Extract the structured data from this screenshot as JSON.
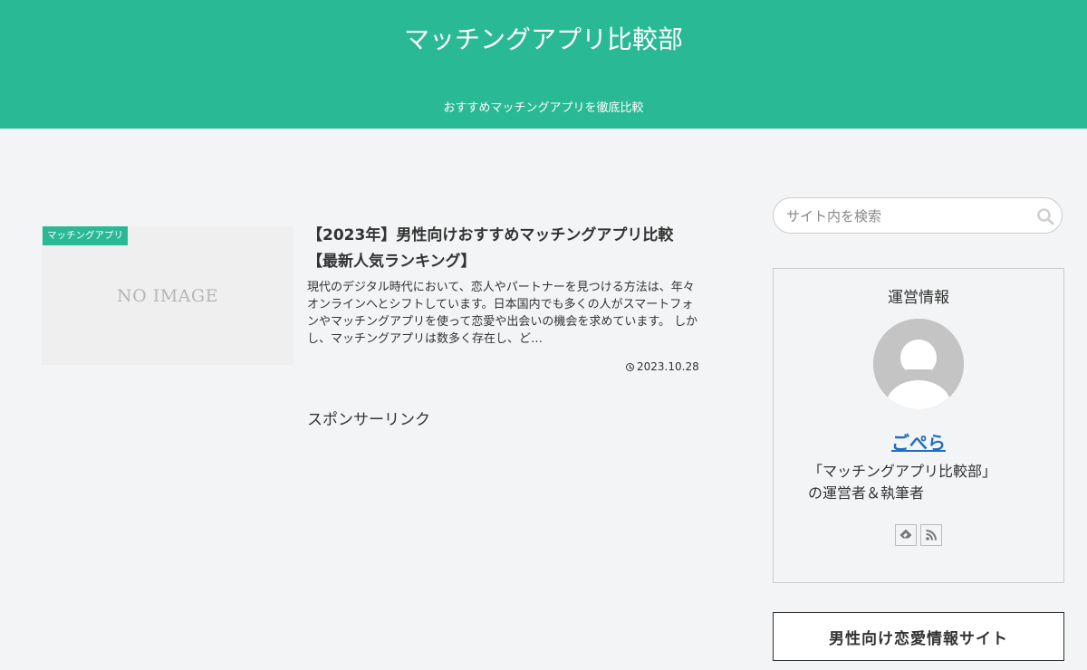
{
  "header": {
    "site_title": "マッチングアプリ比較部",
    "tagline": "おすすめマッチングアプリを徹底比較"
  },
  "article": {
    "category": "マッチングアプリ",
    "thumbnail_text": "NO IMAGE",
    "title_line1": "【2023年】男性向けおすすめマッチングアプリ比較",
    "title_line2": "【最新人気ランキング】",
    "excerpt": "現代のデジタル時代において、恋人やパートナーを見つける方法は、年々オンラインへとシフトしています。日本国内でも多くの人がスマートフォンやマッチングアプリを使って恋愛や出会いの機会を求めています。 しかし、マッチングアプリは数多く存在し、ど…",
    "date": "2023.10.28"
  },
  "sponsor_label": "スポンサーリンク",
  "sidebar": {
    "search_placeholder": "サイト内を検索",
    "profile": {
      "heading": "運営情報",
      "author_name": "ごぺら",
      "desc_line1": "「マッチングアプリ比較部」",
      "desc_line2": "の運営者＆執筆者",
      "social_icons": [
        "feedly-icon",
        "rss-icon"
      ]
    },
    "widget_title": "男性向け恋愛情報サイト"
  },
  "colors": {
    "accent": "#29b995",
    "background": "#f3f4f5",
    "link": "#1e6dc4"
  }
}
